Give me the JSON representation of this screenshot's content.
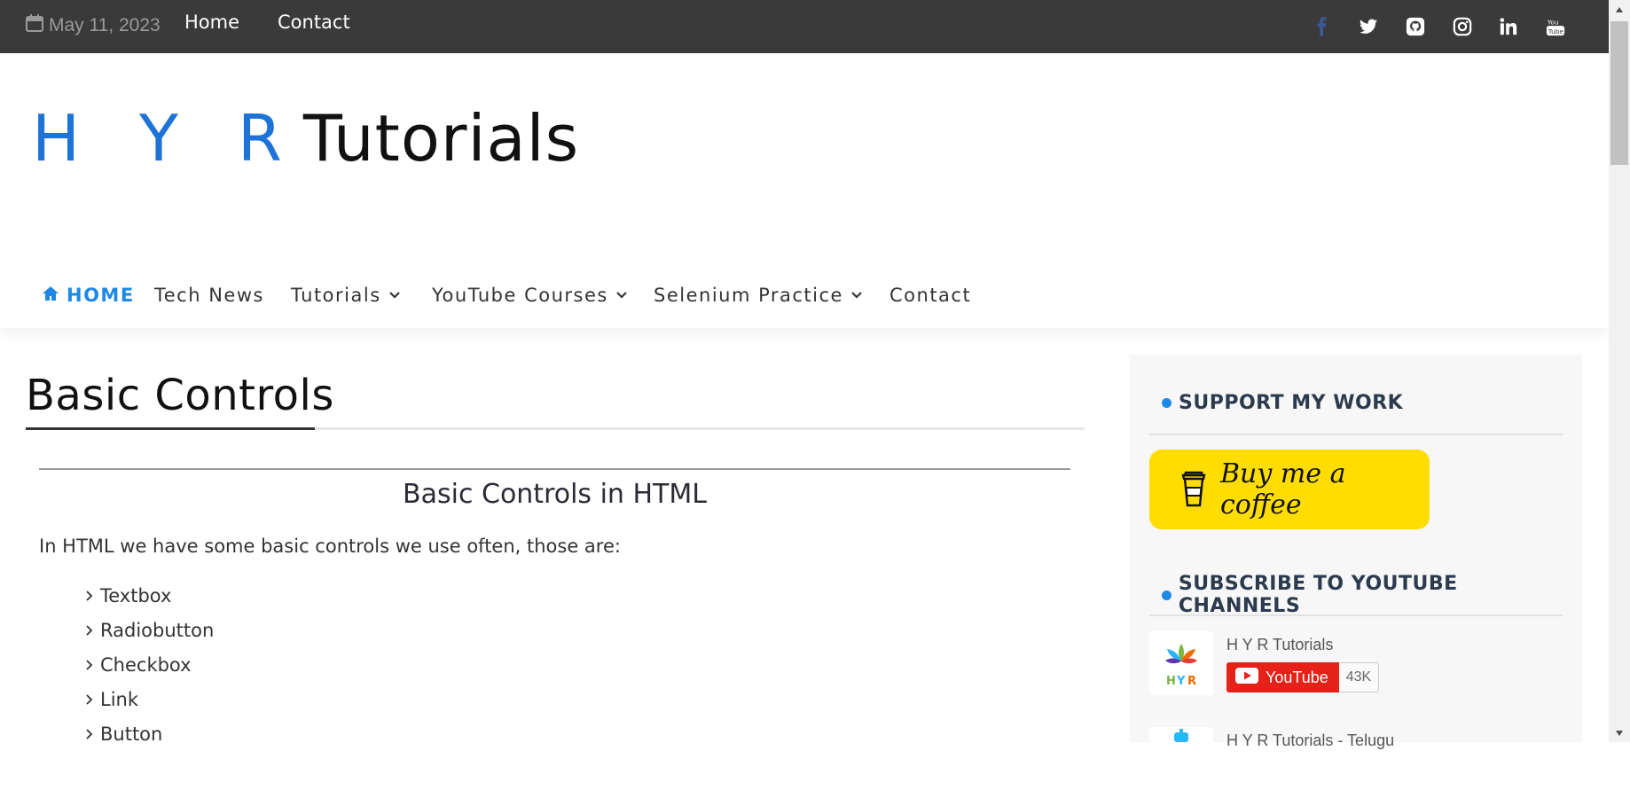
{
  "topbar": {
    "date": "May 11, 2023",
    "links": [
      "Home",
      "Contact"
    ],
    "social_icons": [
      "facebook-icon",
      "twitter-icon",
      "github-icon",
      "instagram-icon",
      "linkedin-icon",
      "youtube-icon"
    ]
  },
  "logo": {
    "part1": "H Y R",
    "part2": "Tutorials"
  },
  "nav": {
    "items": [
      {
        "label": "HOME",
        "icon": "home-icon",
        "active": true
      },
      {
        "label": "Tech News"
      },
      {
        "label": "Tutorials",
        "dropdown": true
      },
      {
        "label": "YouTube Courses",
        "dropdown": true
      },
      {
        "label": "Selenium Practice",
        "dropdown": true
      },
      {
        "label": "Contact"
      }
    ]
  },
  "main": {
    "title": "Basic Controls",
    "heading": "Basic Controls in HTML",
    "intro": "In HTML we have some basic controls we use often, those are:",
    "controls": [
      "Textbox",
      "Radiobutton",
      "Checkbox",
      "Link",
      "Button"
    ]
  },
  "sidebar": {
    "support_title": "SUPPORT MY WORK",
    "bmc_label": "Buy me a coffee",
    "subscribe_title": "SUBSCRIBE TO YOUTUBE CHANNELS",
    "channels": [
      {
        "name": "H Y R Tutorials",
        "button": "YouTube",
        "count": "43K"
      },
      {
        "name": "H Y R Tutorials - Telugu"
      }
    ]
  },
  "colors": {
    "topbar_bg": "#3a3a3a",
    "accent": "#1e88e5",
    "bmc_yellow": "#ffdd00",
    "youtube_red": "#e62117",
    "facebook_blue": "#3b5998"
  }
}
